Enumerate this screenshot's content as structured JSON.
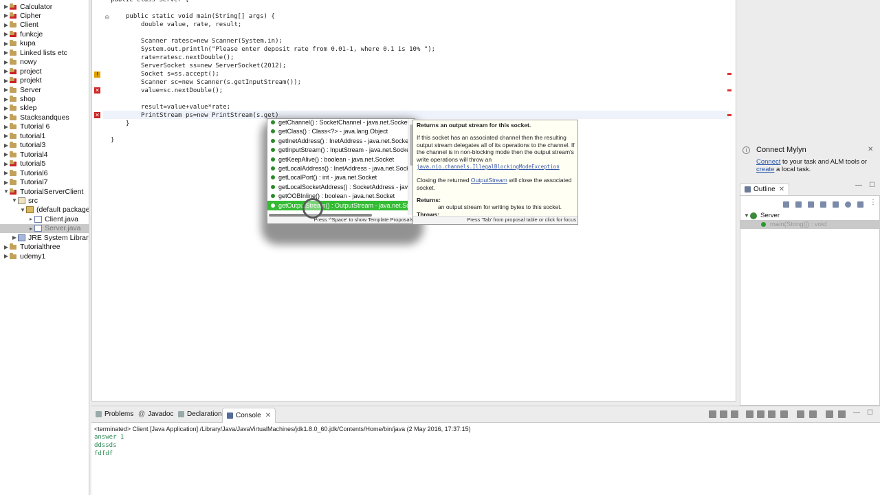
{
  "package_explorer": {
    "items": [
      {
        "label": "Calculator",
        "kind": "project",
        "error": true,
        "expanded": false
      },
      {
        "label": "Cipher",
        "kind": "project",
        "error": true,
        "expanded": false
      },
      {
        "label": "Client",
        "kind": "project",
        "error": false,
        "expanded": false
      },
      {
        "label": "funkcje",
        "kind": "project",
        "error": true,
        "expanded": false
      },
      {
        "label": "kupa",
        "kind": "project",
        "error": false,
        "expanded": false
      },
      {
        "label": "Linked lists etc",
        "kind": "project",
        "error": false,
        "expanded": false
      },
      {
        "label": "nowy",
        "kind": "project",
        "error": false,
        "expanded": false
      },
      {
        "label": "project",
        "kind": "project",
        "error": true,
        "expanded": false
      },
      {
        "label": "projekt",
        "kind": "project",
        "error": true,
        "expanded": false
      },
      {
        "label": "Server",
        "kind": "project",
        "error": false,
        "expanded": false
      },
      {
        "label": "shop",
        "kind": "project",
        "error": false,
        "expanded": false
      },
      {
        "label": "sklep",
        "kind": "project",
        "error": false,
        "expanded": false
      },
      {
        "label": "Stacksandques",
        "kind": "project",
        "error": false,
        "expanded": false
      },
      {
        "label": "Tutorial 6",
        "kind": "project",
        "error": false,
        "expanded": false
      },
      {
        "label": "tutorial1",
        "kind": "project",
        "error": false,
        "expanded": false
      },
      {
        "label": "tutorial3",
        "kind": "project",
        "error": false,
        "expanded": false
      },
      {
        "label": "Tutorial4",
        "kind": "project",
        "error": false,
        "expanded": false
      },
      {
        "label": "tutorial5",
        "kind": "project",
        "error": true,
        "expanded": false
      },
      {
        "label": "Tutorial6",
        "kind": "project",
        "error": false,
        "expanded": false
      },
      {
        "label": "Tutorial7",
        "kind": "project",
        "error": false,
        "expanded": false
      },
      {
        "label": "TutorialServerClient",
        "kind": "project",
        "error": true,
        "expanded": true
      },
      {
        "label": "src",
        "kind": "src",
        "error": false,
        "expanded": true
      },
      {
        "label": "(default package)",
        "kind": "package",
        "error": false,
        "expanded": true
      },
      {
        "label": "Client.java",
        "kind": "file",
        "error": false,
        "expanded": false
      },
      {
        "label": "Server.java",
        "kind": "file",
        "error": true,
        "expanded": false,
        "selected": true
      },
      {
        "label": "JRE System Library",
        "kind": "library",
        "error": false,
        "expanded": false
      },
      {
        "label": "Tutorialthree",
        "kind": "project",
        "error": false,
        "expanded": false
      },
      {
        "label": "udemy1",
        "kind": "project",
        "error": false,
        "expanded": false
      }
    ]
  },
  "editor": {
    "lines": [
      {
        "text": "public class Server {",
        "indent": 0
      },
      {
        "text": "public static void main(String[] args) {",
        "indent": 1
      },
      {
        "text": "double value, rate, result;",
        "indent": 2
      },
      {
        "text": "",
        "indent": 0
      },
      {
        "text": "Scanner ratesc=new Scanner(System.in);",
        "indent": 2
      },
      {
        "text": "System.out.println(\"Please enter deposit rate from 0.01-1, where 0.1 is 10% \");",
        "indent": 2
      },
      {
        "text": "rate=ratesc.nextDouble();",
        "indent": 2
      },
      {
        "text": "ServerSocket ss=new ServerSocket(2012);",
        "indent": 2
      },
      {
        "text": "Socket s=ss.accept();",
        "indent": 2
      },
      {
        "text": "Scanner sc=new Scanner(s.getInputStream());",
        "indent": 2
      },
      {
        "text": "value=sc.nextDouble();",
        "indent": 2
      },
      {
        "text": "",
        "indent": 0
      },
      {
        "text": "result=value+value*rate;",
        "indent": 2
      },
      {
        "text": "PrintStream ps=new PrintStream(s.get)",
        "indent": 2
      },
      {
        "text": "}",
        "indent": 1
      },
      {
        "text": "",
        "indent": 0
      },
      {
        "text": "}",
        "indent": 0
      }
    ]
  },
  "autocomplete": {
    "items": [
      "getChannel() : SocketChannel - java.net.Socket",
      "getClass() : Class<?> - java.lang.Object",
      "getInetAddress() : InetAddress - java.net.Socket",
      "getInputStream() : InputStream - java.net.Socket",
      "getKeepAlive() : boolean - java.net.Socket",
      "getLocalAddress() : InetAddress - java.net.Socket",
      "getLocalPort() : int - java.net.Socket",
      "getLocalSocketAddress() : SocketAddress - java.net.Socket",
      "getOOBInline() : boolean - java.net.Socket",
      "getOutputStream() : OutputStream - java.net.Socket"
    ],
    "selected_index": 9,
    "footer": "Press '^Space' to show Template Proposals"
  },
  "javadoc": {
    "summary": "Returns an output stream for this socket.",
    "para1": "If this socket has an associated channel then the resulting output stream delegates all of its operations to the channel. If the channel is in non-blocking mode then the output stream's write operations will throw an",
    "exception_link": "java.nio.channels.IllegalBlockingModeException",
    "para2_pre": "Closing the returned",
    "para2_link": "OutputStream",
    "para2_post": "will close the associated socket.",
    "returns_label": "Returns:",
    "returns_text": "an output stream for writing bytes to this socket.",
    "throws_label": "Throws:",
    "footer": "Press 'Tab' from proposal table or click for focus"
  },
  "mylyn": {
    "title": "Connect Mylyn",
    "link1": "Connect",
    "text1": "to your task and ALM tools or",
    "link2": "create",
    "text2": "a local task."
  },
  "outline": {
    "tab_label": "Outline",
    "class_name": "Server",
    "method": "main(String[]) : void"
  },
  "console": {
    "tabs": [
      "Problems",
      "Javadoc",
      "Declaration",
      "Console"
    ],
    "active_tab": "Console",
    "header": "<terminated> Client [Java Application] /Library/Java/JavaVirtualMachines/jdk1.8.0_60.jdk/Contents/Home/bin/java (2 May 2016, 17:37:15)",
    "output": [
      "answer 1",
      "ddssds",
      "fdfdf"
    ]
  }
}
